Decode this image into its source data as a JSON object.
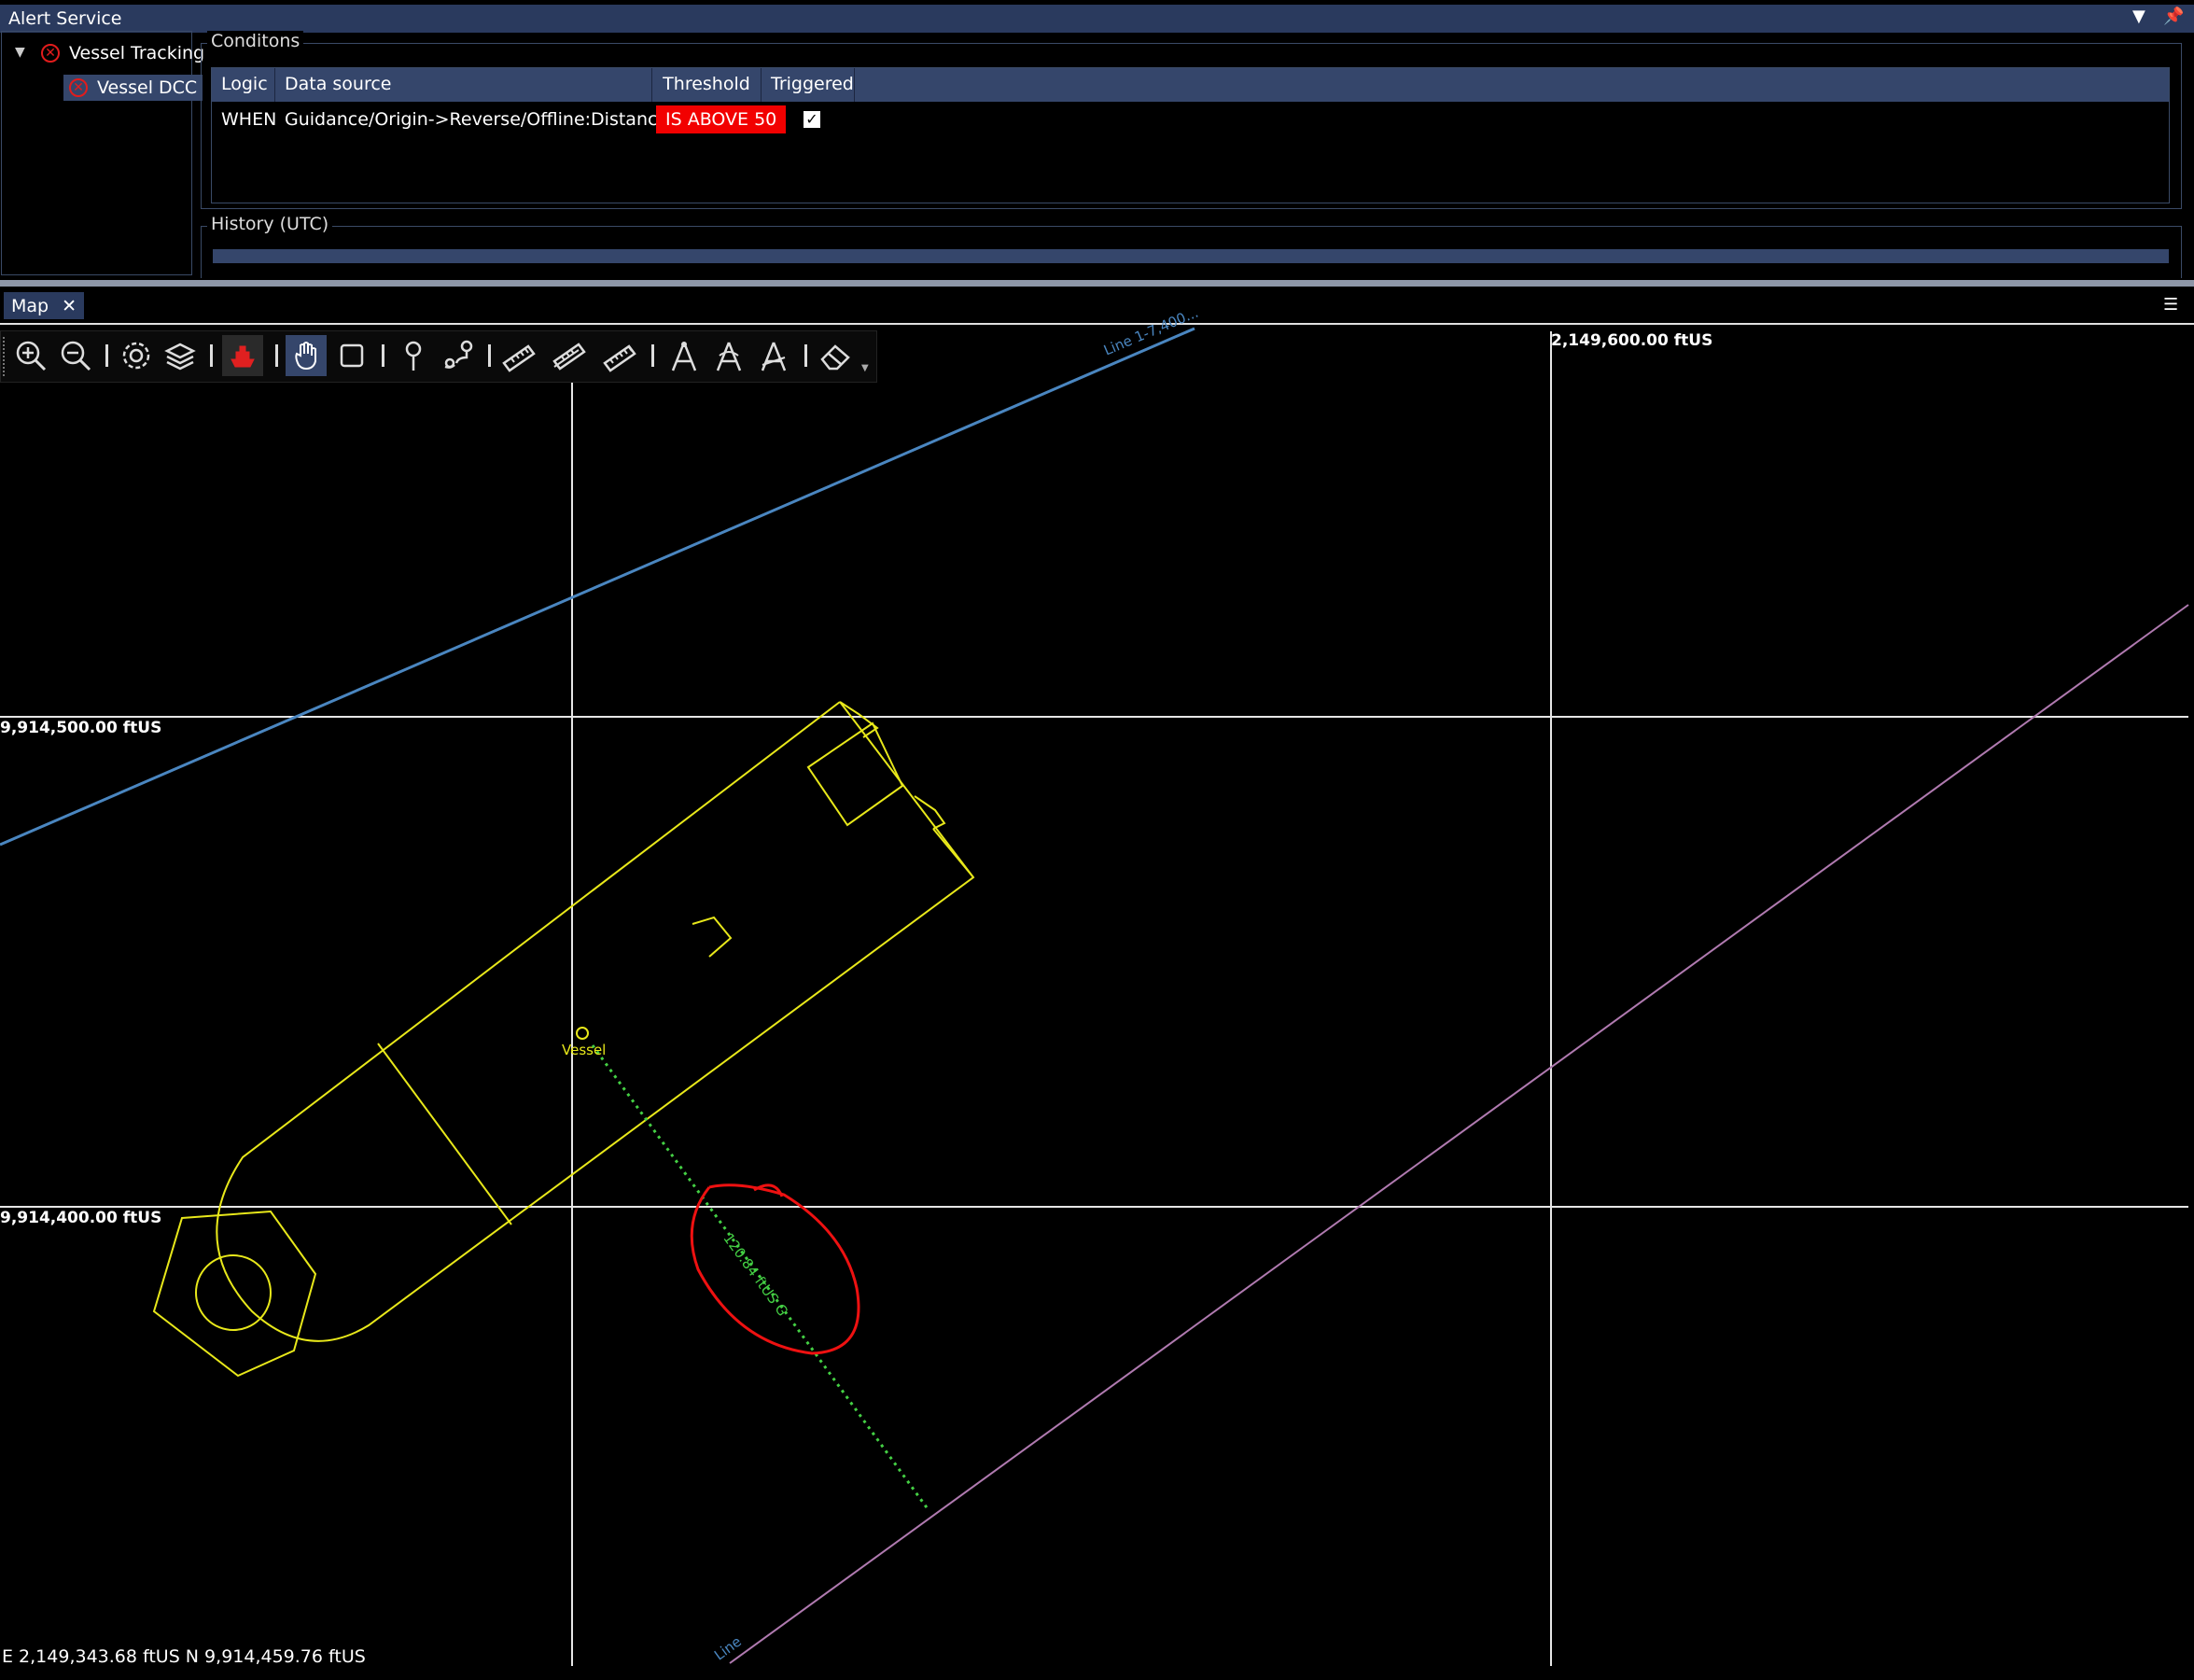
{
  "window": {
    "title": "Alert Service"
  },
  "tree": {
    "items": [
      {
        "label": "Vessel Tracking",
        "status_icon": "error-icon"
      },
      {
        "label": "Vessel DCC",
        "status_icon": "error-icon"
      }
    ]
  },
  "conditions": {
    "legend": "Conditons",
    "columns": [
      "Logic",
      "Data source",
      "Threshold",
      "Triggered"
    ],
    "rows": [
      {
        "logic": "WHEN",
        "data_source": "Guidance/Origin->Reverse/Offline:Distance(ftUS)",
        "threshold": "IS ABOVE 50",
        "triggered": "✓"
      }
    ]
  },
  "history": {
    "legend": "History (UTC)"
  },
  "map": {
    "tab_label": "Map",
    "close_glyph": "✕",
    "grid_labels": {
      "easting": "2,149,600.00 ftUS",
      "northing_top": "9,914,500.00 ftUS",
      "northing_bottom": "9,914,400.00 ftUS"
    },
    "line_labels": {
      "blue": "Line 1-7,400...",
      "purple": "Line"
    },
    "vessel_label": "Vessel",
    "distance_label": "120.84 ftUS G",
    "status": "E 2,149,343.68 ftUS N 9,914,459.76 ftUS"
  },
  "toolbar": {
    "tools": [
      "zoom-in",
      "zoom-out",
      "settings",
      "layers",
      "vessel",
      "pan",
      "select-rectangle",
      "pin",
      "route",
      "ruler",
      "ruler-multi",
      "ruler-grid",
      "compass-a",
      "compass-b",
      "compass-c",
      "eraser"
    ]
  },
  "colors": {
    "accent": "#2a3a5e",
    "header": "#35466b",
    "error": "#f20000",
    "vessel": "#e8e81a",
    "line_blue": "#4a86c0",
    "line_purple": "#b07ab0",
    "distance": "#44d044"
  }
}
